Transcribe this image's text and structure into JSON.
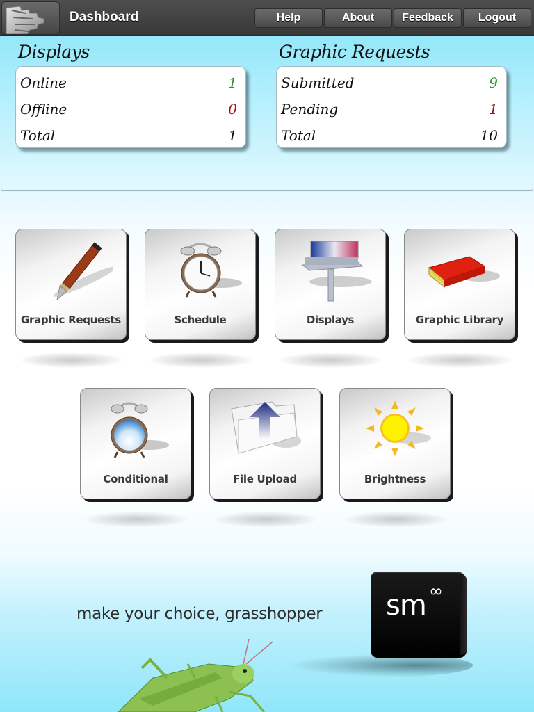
{
  "header": {
    "logo_icon": "gear-icon",
    "title": "Dashboard",
    "nav": [
      {
        "label": "Help"
      },
      {
        "label": "About"
      },
      {
        "label": "Feedback"
      },
      {
        "label": "Logout"
      }
    ]
  },
  "stats": {
    "displays": {
      "title": "Displays",
      "rows": [
        {
          "label": "Online",
          "value": "1",
          "color": "#2a9a2a"
        },
        {
          "label": "Offline",
          "value": "0",
          "color": "#9a1010"
        },
        {
          "label": "Total",
          "value": "1",
          "color": "#111111"
        }
      ]
    },
    "graphic_requests": {
      "title": "Graphic Requests",
      "rows": [
        {
          "label": "Submitted",
          "value": "9",
          "color": "#2a9a2a"
        },
        {
          "label": "Pending",
          "value": "1",
          "color": "#9a1010"
        },
        {
          "label": "Total",
          "value": "10",
          "color": "#111111"
        }
      ]
    }
  },
  "tiles": [
    {
      "label": "Graphic Requests",
      "icon": "fountain-pen-icon"
    },
    {
      "label": "Schedule",
      "icon": "alarm-clock-icon"
    },
    {
      "label": "Displays",
      "icon": "billboard-icon"
    },
    {
      "label": "Graphic Library",
      "icon": "book-icon"
    },
    {
      "label": "Conditional",
      "icon": "cloud-clock-icon"
    },
    {
      "label": "File Upload",
      "icon": "folder-upload-icon"
    },
    {
      "label": "Brightness",
      "icon": "sun-icon"
    }
  ],
  "promo": {
    "tagline": "make your choice, grasshopper",
    "brand_text": "sm",
    "brand_superscript": "∞"
  }
}
